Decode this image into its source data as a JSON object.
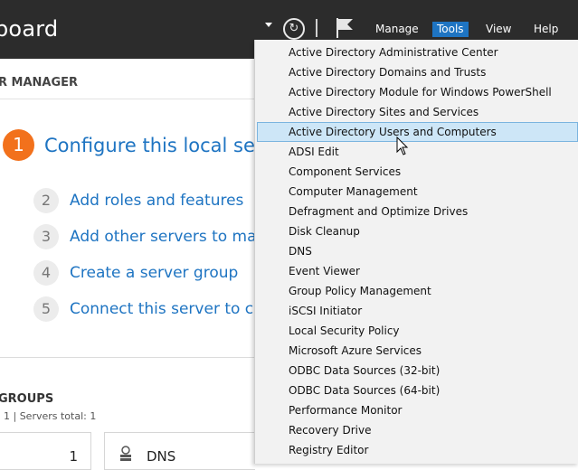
{
  "titlebar": {
    "title": "board",
    "menus": [
      "Manage",
      "Tools",
      "View",
      "Help"
    ]
  },
  "left": {
    "section_header": "R MANAGER",
    "steps": [
      {
        "num": "1",
        "label": "Configure this local ser"
      },
      {
        "num": "2",
        "label": "Add roles and features"
      },
      {
        "num": "3",
        "label": "Add other servers to man"
      },
      {
        "num": "4",
        "label": "Create a server group"
      },
      {
        "num": "5",
        "label": "Connect this server to clou"
      }
    ],
    "groups_header": "GROUPS",
    "groups_sub": "1  |  Servers total: 1",
    "tile1_count": "1",
    "tile2_label": "DNS"
  },
  "tools_menu": {
    "items": [
      "Active Directory Administrative Center",
      "Active Directory Domains and Trusts",
      "Active Directory Module for Windows PowerShell",
      "Active Directory Sites and Services",
      "Active Directory Users and Computers",
      "ADSI Edit",
      "Component Services",
      "Computer Management",
      "Defragment and Optimize Drives",
      "Disk Cleanup",
      "DNS",
      "Event Viewer",
      "Group Policy Management",
      "iSCSI Initiator",
      "Local Security Policy",
      "Microsoft Azure Services",
      "ODBC Data Sources (32-bit)",
      "ODBC Data Sources (64-bit)",
      "Performance Monitor",
      "Recovery Drive",
      "Registry Editor"
    ],
    "hovered_index": 4
  },
  "colors": {
    "titlebar": "#2c2c2c",
    "accent": "#1e74c2",
    "step1": "#f2711c",
    "hover_bg": "#cde6f7"
  }
}
